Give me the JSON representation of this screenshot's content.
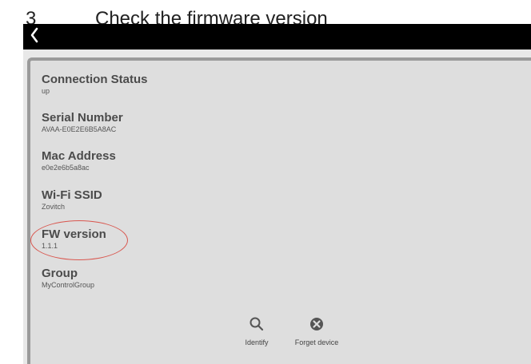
{
  "step": {
    "number": "3",
    "text": "Check the firmware version"
  },
  "nav": {
    "back_icon": "chevron-left-icon"
  },
  "fields": [
    {
      "label": "Connection Status",
      "value": "up"
    },
    {
      "label": "Serial Number",
      "value": "AVAA-E0E2E6B5A8AC"
    },
    {
      "label": "Mac Address",
      "value": "e0e2e6b5a8ac"
    },
    {
      "label": "Wi-Fi SSID",
      "value": "Zovitch"
    },
    {
      "label": "FW version",
      "value": "1.1.1"
    },
    {
      "label": "Group",
      "value": "MyControlGroup"
    }
  ],
  "actions": {
    "identify": {
      "label": "Identify",
      "icon": "search-icon"
    },
    "forget": {
      "label": "Forget device",
      "icon": "close-circle-icon"
    }
  },
  "colors": {
    "topbar": "#000000",
    "panel": "#dedede",
    "highlight": "#d9574f"
  }
}
